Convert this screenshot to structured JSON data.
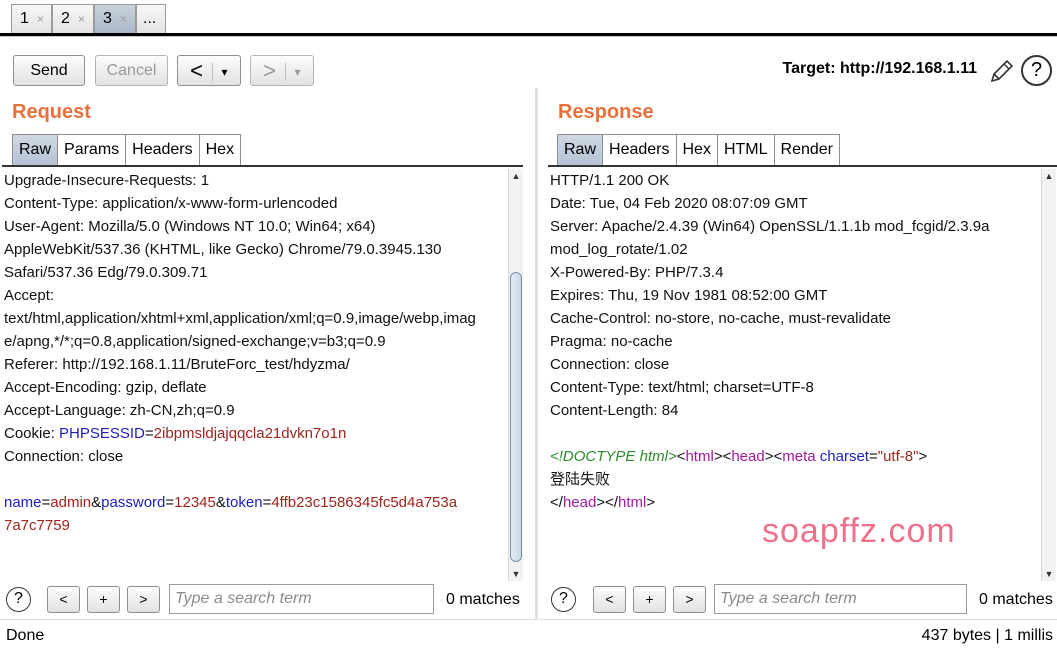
{
  "tabs": [
    {
      "label": "1",
      "close": "×"
    },
    {
      "label": "2",
      "close": "×"
    },
    {
      "label": "3",
      "close": "×",
      "selected": true
    },
    {
      "label": "..."
    }
  ],
  "toolbar": {
    "send_label": "Send",
    "cancel_label": "Cancel",
    "back_arrow": "<",
    "forward_arrow": ">",
    "dropdown_glyph": "▾",
    "target_label": "Target: http://192.168.1.11",
    "help_glyph": "?"
  },
  "request": {
    "title": "Request",
    "tabs": [
      "Raw",
      "Params",
      "Headers",
      "Hex"
    ],
    "lines": [
      "Upgrade-Insecure-Requests: 1",
      "Content-Type: application/x-www-form-urlencoded",
      "User-Agent: Mozilla/5.0 (Windows NT 10.0; Win64; x64)",
      "AppleWebKit/537.36 (KHTML, like Gecko) Chrome/79.0.3945.130",
      "Safari/537.36 Edg/79.0.309.71",
      "Accept:",
      "text/html,application/xhtml+xml,application/xml;q=0.9,image/webp,imag",
      "e/apng,*/*;q=0.8,application/signed-exchange;v=b3;q=0.9",
      "Referer: http://192.168.1.11/BruteForc_test/hdyzma/",
      "Accept-Encoding: gzip, deflate",
      "Accept-Language: zh-CN,zh;q=0.9"
    ],
    "cookie": {
      "prefix": "Cookie: ",
      "key": "PHPSESSID",
      "eq": "=",
      "value": "2ibpmsldjajqqcla21dvkn7o1n"
    },
    "connection": "Connection: close",
    "body": {
      "k1": "name",
      "v1": "admin",
      "amp1": "&",
      "k2": "password",
      "v2": "12345",
      "amp2": "&",
      "k3": "token",
      "v3a": "4ffb23c1586345fc5d4a753a",
      "v3b": "7a7c7759",
      "eq": "="
    },
    "search_placeholder": "Type a search term",
    "matches": "0 matches"
  },
  "response": {
    "title": "Response",
    "tabs": [
      "Raw",
      "Headers",
      "Hex",
      "HTML",
      "Render"
    ],
    "lines": [
      "HTTP/1.1 200 OK",
      "Date: Tue, 04 Feb 2020 08:07:09 GMT",
      "Server: Apache/2.4.39 (Win64) OpenSSL/1.1.1b mod_fcgid/2.3.9a",
      "mod_log_rotate/1.02",
      "X-Powered-By: PHP/7.3.4",
      "Expires: Thu, 19 Nov 1981 08:52:00 GMT",
      "Cache-Control: no-store, no-cache, must-revalidate",
      "Pragma: no-cache",
      "Connection: close",
      "Content-Type: text/html; charset=UTF-8",
      "Content-Length: 84"
    ],
    "html": {
      "doctype": "<!DOCTYPE html>",
      "lt": "<",
      "gt": ">",
      "close_lt": "</",
      "tag_html": "html",
      "tag_head": "head",
      "tag_meta": "meta",
      "attr_charset": "charset",
      "eq": "=",
      "charset_value": "\"utf-8\"",
      "body_text": "登陆失败"
    },
    "search_placeholder": "Type a search term",
    "matches": "0 matches"
  },
  "search_buttons": {
    "prev": "<",
    "add": "+",
    "next": ">"
  },
  "status": {
    "left": "Done",
    "right": "437 bytes | 1 millis"
  },
  "watermark": "soapffz.com"
}
